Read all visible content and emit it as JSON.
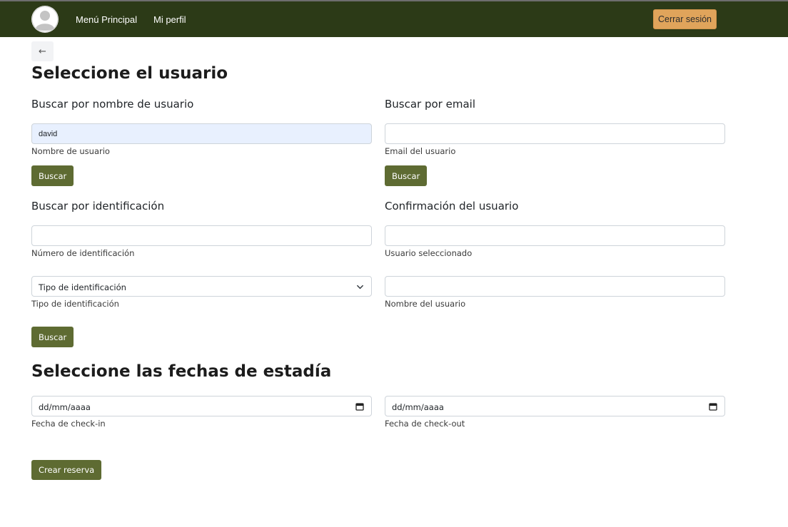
{
  "navbar": {
    "menu_label": "Menú Principal",
    "profile_label": "Mi perfil",
    "logout_label": "Cerrar sesión"
  },
  "back": {
    "icon": "arrow-left-icon",
    "glyph": "←"
  },
  "user_section": {
    "title": "Seleccione el usuario",
    "by_username": {
      "heading": "Buscar por nombre de usuario",
      "value": "david",
      "label": "Nombre de usuario",
      "button": "Buscar"
    },
    "by_email": {
      "heading": "Buscar por email",
      "value": "",
      "label": "Email del usuario",
      "button": "Buscar"
    },
    "by_id": {
      "heading": "Buscar por identificación",
      "number_value": "",
      "number_label": "Número de identificación",
      "type_selected": "Tipo de identificación",
      "type_label": "Tipo de identificación",
      "button": "Buscar"
    },
    "confirmation": {
      "heading": "Confirmación del usuario",
      "selected_value": "",
      "selected_label": "Usuario seleccionado",
      "name_value": "",
      "name_label": "Nombre del usuario"
    }
  },
  "dates_section": {
    "title": "Seleccione las fechas de estadía",
    "checkin_placeholder": "dd/mm/aaaa",
    "checkin_label": "Fecha de check-in",
    "checkout_placeholder": "dd/mm/aaaa",
    "checkout_label": "Fecha de check-out"
  },
  "create_button": "Crear reserva",
  "colors": {
    "navbar": "#2c3a17",
    "accent_button": "#5e6b32",
    "logout_button": "#e0a45b",
    "autofill_background": "#e8f0fe"
  }
}
